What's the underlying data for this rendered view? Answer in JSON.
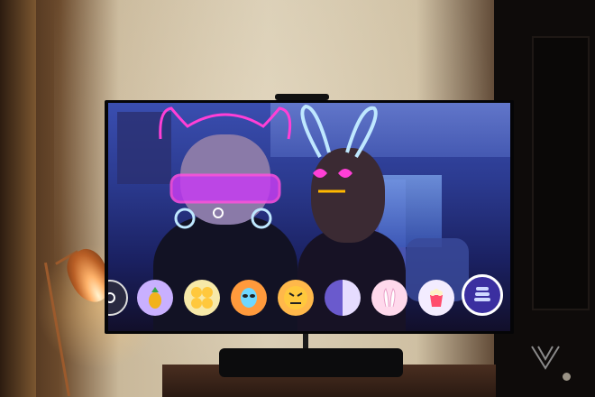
{
  "scene": {
    "description_free": true
  },
  "filter_bar": {
    "items": [
      {
        "name": "partial-icon"
      },
      {
        "name": "pineapple-filter-icon"
      },
      {
        "name": "emoji-faces-filter-icon"
      },
      {
        "name": "alien-face-filter-icon"
      },
      {
        "name": "angry-face-filter-icon"
      },
      {
        "name": "split-color-filter-icon"
      },
      {
        "name": "bunny-ears-filter-icon"
      },
      {
        "name": "popcorn-filter-icon"
      },
      {
        "name": "stacked-hat-filter-icon"
      }
    ],
    "selected_index": 8
  },
  "colors": {
    "neon_pink": "#ff3fd6",
    "neon_cyan": "#bfe8ff",
    "neon_yellow": "#ffb800",
    "screen_blue": "#2b3a8f",
    "selected_ring": "#ffffff"
  }
}
